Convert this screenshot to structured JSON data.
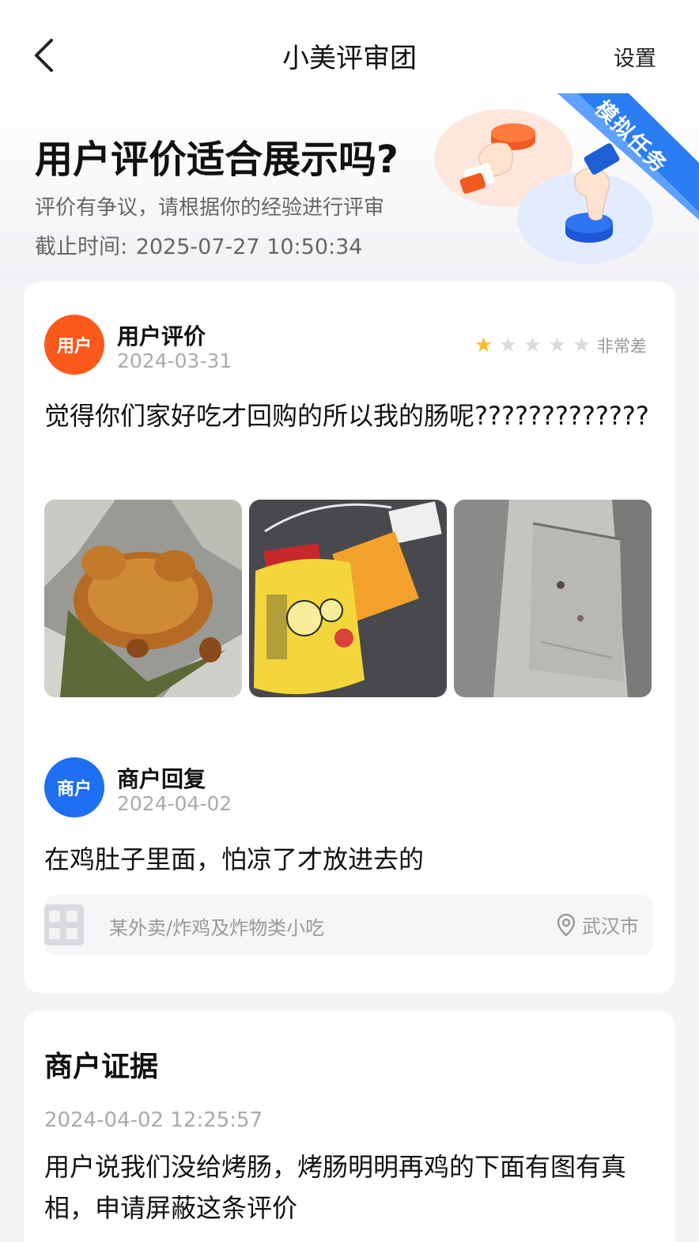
{
  "nav": {
    "title": "小美评审团",
    "settings_label": "设置",
    "back_icon": "chevron-left-icon"
  },
  "hero": {
    "title": "用户评价适合展示吗?",
    "subtitle": "评价有争议，请根据你的经验进行评审",
    "deadline_label": "截止时间:",
    "deadline_value": "2025-07-27 10:50:34",
    "ribbon_text": "模拟任务"
  },
  "review": {
    "avatar_text": "用户",
    "author": "用户评价",
    "date": "2024-03-31",
    "rating": 1,
    "rating_max": 5,
    "rating_text": "非常差",
    "text": "觉得你们家好吃才回购的所以我的肠呢?????????????",
    "photos": [
      "roast-chicken-photo",
      "sauce-packets-photo",
      "foil-bag-photo"
    ]
  },
  "merchant_reply": {
    "avatar_text": "商户",
    "author": "商户回复",
    "date": "2024-04-02",
    "text": "在鸡肚子里面，怕凉了才放进去的"
  },
  "shop": {
    "category": "某外卖/炸鸡及炸物类小吃",
    "city": "武汉市",
    "location_icon": "location-pin-icon"
  },
  "evidence": {
    "title": "商户证据",
    "time": "2024-04-02 12:25:57",
    "text": "用户说我们没给烤肠，烤肠明明再鸡的下面有图有真相，申请屏蔽这条评价"
  },
  "colors": {
    "user_avatar": "#fb5a1c",
    "merchant_avatar": "#1e6ff1",
    "star_on": "#f8b92a",
    "star_off": "#dadada",
    "ribbon": "#2a7df2"
  }
}
